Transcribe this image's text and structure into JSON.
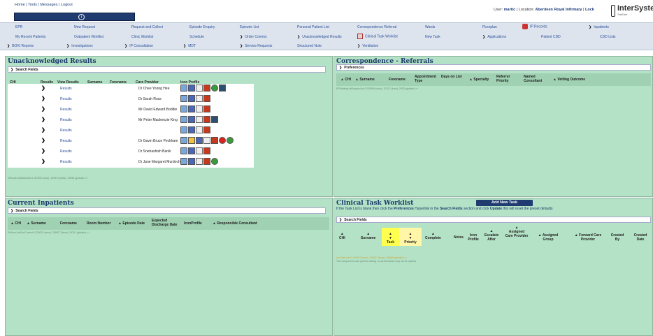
{
  "top": {
    "links": [
      "Home",
      "Tools",
      "Messages",
      "Logout"
    ],
    "separator": " | ",
    "info_icon": "info-icon"
  },
  "user": {
    "user_label": "User:",
    "user_name": "martic",
    "location_label": "Location:",
    "location_name": "Aberdeen Royal Infirmary",
    "lock": "Lock",
    "logo_word": "InterSystem",
    "logo_sub": "TrakCare"
  },
  "menu": {
    "row1": [
      "EPR",
      "New Request",
      "Request and Collect",
      "Episode Enquiry",
      "Episode List",
      "Personal Patient List",
      "Correspondence Referral",
      "Wards",
      "Floorplan",
      "IP Records",
      "Inpatients"
    ],
    "row2": [
      "My Recent Patients",
      "Outpatient Worklist",
      "Clinic Worklist",
      "Schedule",
      "Order Comms",
      "Unacknowledged Results",
      "Clinical Task Worklist",
      "New Task",
      "Applications",
      "Patient CDD",
      "CDD Lists"
    ],
    "row3": [
      "BOXI Reports",
      "Investigations",
      "IP Consultation",
      "MDT",
      "Service Requests",
      "Structured Note",
      "Ventilation"
    ]
  },
  "unack": {
    "title": "Unacknowledged Results",
    "search_fields": "Search Fields",
    "columns": [
      "CHI",
      "Results",
      "View Results",
      "Surname",
      "Forename",
      "Care Provider",
      "Icon Profile"
    ],
    "rows": [
      {
        "result": "Results",
        "provider": "Dr Chee Yoong Hee",
        "icons": [
          "book",
          "person",
          "tube",
          "grid",
          "leaf",
          "dark"
        ]
      },
      {
        "result": "Results",
        "provider": "Dr Sarah Ross",
        "icons": [
          "book",
          "person",
          "tube",
          "grid"
        ]
      },
      {
        "result": "Results",
        "provider": "Mr David Edward Boddie",
        "icons": [
          "book",
          "person",
          "tube",
          "grid"
        ]
      },
      {
        "result": "Results",
        "provider": "Mr Peter Mackenzie King",
        "icons": [
          "book",
          "person",
          "tube",
          "grid",
          "dark"
        ]
      },
      {
        "result": "Results",
        "provider": "",
        "icons": [
          "book",
          "person",
          "tube",
          "grid"
        ]
      },
      {
        "result": "Results",
        "provider": "Dr Gavin Bruce Peckham",
        "icons": [
          "book",
          "nurse",
          "person",
          "tube",
          "grid",
          "stop",
          "leaf"
        ]
      },
      {
        "result": "Results",
        "provider": "Dr Snehashish Banik",
        "icons": [
          "book",
          "person",
          "tube",
          "grid"
        ]
      },
      {
        "result": "Results",
        "provider": "Dr Jane Margaret Murdoch",
        "icons": [
          "book",
          "person",
          "tube",
          "grid",
          "leaf"
        ]
      }
    ],
    "diag": "UResult.ListEpisodes 0.167899 (secs), 129574 (lines), 13058 (globals) >>"
  },
  "corr": {
    "title": "Correspondence - Referrals",
    "preferences": "Preferences",
    "columns": [
      "CHI",
      "Surname",
      "Forename",
      "Appointment Type",
      "Days on List",
      "Specialty",
      "Referrer Priority",
      "Named Consultant",
      "Vetting Outcome"
    ],
    "diag": "RFWaitingListEnquiry.List 0.023999 (secs), 20127 (lines), 2933 (globals) >>"
  },
  "inpat": {
    "title": "Current Inpatients",
    "search_fields": "Search Fields",
    "columns": [
      "CHI",
      "Surname",
      "Forename",
      "Room Number",
      "Episode Date",
      "Expected Discharge Date",
      "IconProfile",
      "Responsible Consultant"
    ],
    "diag": "PAAdm.ListDocCurrent 0.220021 (secs), 295877 (lines), 34791 (globals) >>"
  },
  "task": {
    "title": "Clinical Task Worklist",
    "add_button": "Add New Task",
    "note_pre": "If the Task List is blank then click the ",
    "note_pref": "Preferences",
    "note_mid": " Hyperlink in the ",
    "note_sf": "Search Fields",
    "note_mid2": " section and click ",
    "note_upd": "Update",
    "note_post": " this will reset the preset defaults",
    "search_fields": "Search Fields",
    "columns": [
      "CHI",
      "Surname",
      "Task",
      "Priority",
      "Complete",
      "Notes",
      "Icon Profile",
      "Escalate After",
      "Assigned Care Provider",
      "Assigned Group",
      "Forward Care Provider",
      "Created By",
      "Created Date"
    ],
    "diag1": "epr.Task.List 0.149937 (secs), 225037 (lines), 26689 (globals) >>",
    "diag2": "This component uses generic sorting, so performance may not be optimal."
  },
  "colors": {
    "panel_bg": "#b4e2c6",
    "title": "#1b3a6b",
    "link": "#2a4f9a",
    "highlight": "#ffff4d",
    "navy": "#1f3b70"
  }
}
